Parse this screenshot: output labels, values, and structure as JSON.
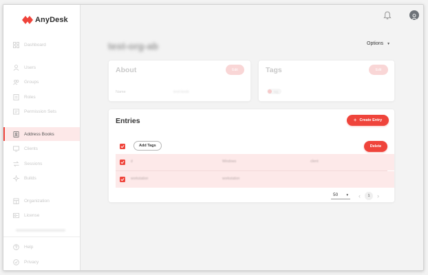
{
  "app": {
    "name": "AnyDesk",
    "brand_color": "#ef443b",
    "logo_icon": "anydesk-logo-icon"
  },
  "sidebar": {
    "items": [
      {
        "id": "dashboard",
        "label": "Dashboard",
        "icon": "dashboard-icon",
        "active": false
      },
      {
        "id": "users",
        "label": "Users",
        "icon": "user-icon",
        "active": false
      },
      {
        "id": "groups",
        "label": "Groups",
        "icon": "groups-icon",
        "active": false
      },
      {
        "id": "roles",
        "label": "Roles",
        "icon": "roles-icon",
        "active": false
      },
      {
        "id": "permission-sets",
        "label": "Permission Sets",
        "icon": "permission-icon",
        "active": false
      },
      {
        "id": "address-books",
        "label": "Address Books",
        "icon": "address-book-icon",
        "active": true
      },
      {
        "id": "clients",
        "label": "Clients",
        "icon": "monitor-icon",
        "active": false
      },
      {
        "id": "sessions",
        "label": "Sessions",
        "icon": "sessions-icon",
        "active": false
      },
      {
        "id": "builds",
        "label": "Builds",
        "icon": "builds-icon",
        "active": false
      },
      {
        "id": "organization",
        "label": "Organization",
        "icon": "building-icon",
        "active": false
      },
      {
        "id": "license",
        "label": "License",
        "icon": "license-icon",
        "active": false
      },
      {
        "id": "help",
        "label": "Help",
        "icon": "help-icon",
        "active": false
      },
      {
        "id": "privacy",
        "label": "Privacy",
        "icon": "privacy-icon",
        "active": false
      }
    ]
  },
  "header": {
    "bell_icon": "bell-icon",
    "avatar_icon": "user-avatar-icon"
  },
  "page": {
    "title": "test-org-ab",
    "options_label": "Options"
  },
  "about": {
    "title": "About",
    "edit_label": "Edit",
    "name_label": "Name",
    "name_value": "test-book"
  },
  "tags": {
    "title": "Tags",
    "edit_label": "Edit",
    "chip_label": "tag"
  },
  "entries": {
    "title": "Entries",
    "create_label": "Create Entry",
    "add_tags_label": "Add Tags",
    "delete_label": "Delete",
    "rows": [
      {
        "name": "d",
        "os": "Windows",
        "tag": "client",
        "checked": true
      },
      {
        "name": "workstation",
        "os": "workstation",
        "tag": "",
        "checked": true
      }
    ],
    "per_page": "50",
    "current_page": "1"
  }
}
